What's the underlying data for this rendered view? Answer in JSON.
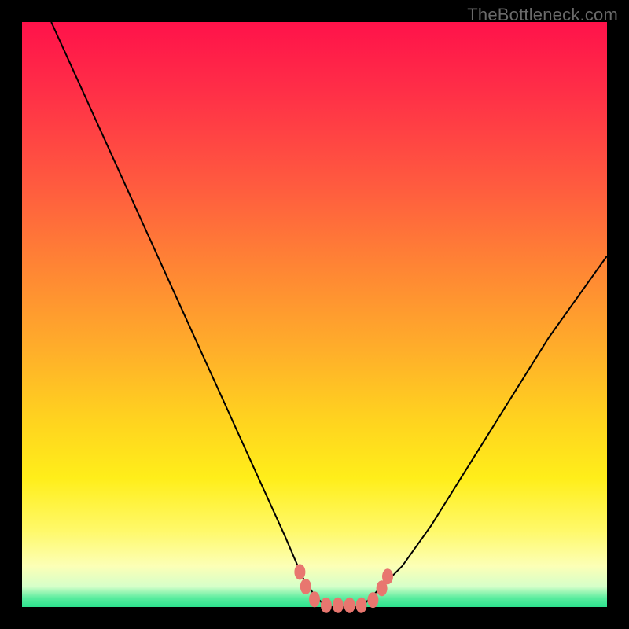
{
  "watermark": "TheBottleneck.com",
  "chart_data": {
    "type": "line",
    "title": "",
    "xlabel": "",
    "ylabel": "",
    "xlim": [
      0,
      100
    ],
    "ylim": [
      0,
      100
    ],
    "grid": false,
    "legend": false,
    "series": [
      {
        "name": "bottleneck-curve",
        "x": [
          5,
          10,
          15,
          20,
          25,
          30,
          35,
          40,
          45,
          48,
          50,
          52,
          54,
          56,
          58,
          60,
          65,
          70,
          75,
          80,
          85,
          90,
          95,
          100
        ],
        "y": [
          100,
          89,
          78,
          67,
          56,
          45,
          34,
          23,
          12,
          5,
          2,
          0,
          0,
          0,
          0,
          2,
          7,
          14,
          22,
          30,
          38,
          46,
          53,
          60
        ]
      }
    ],
    "markers": {
      "name": "highlight-points",
      "color": "#e8766f",
      "points": [
        {
          "x": 47.5,
          "y": 6
        },
        {
          "x": 48.5,
          "y": 3.5
        },
        {
          "x": 50,
          "y": 1.3
        },
        {
          "x": 52,
          "y": 0.3
        },
        {
          "x": 54,
          "y": 0.3
        },
        {
          "x": 56,
          "y": 0.3
        },
        {
          "x": 58,
          "y": 0.3
        },
        {
          "x": 60,
          "y": 1.2
        },
        {
          "x": 61.5,
          "y": 3.2
        },
        {
          "x": 62.5,
          "y": 5.2
        }
      ]
    }
  },
  "colors": {
    "curve": "#000000",
    "marker": "#e8766f",
    "frame": "#000000"
  }
}
